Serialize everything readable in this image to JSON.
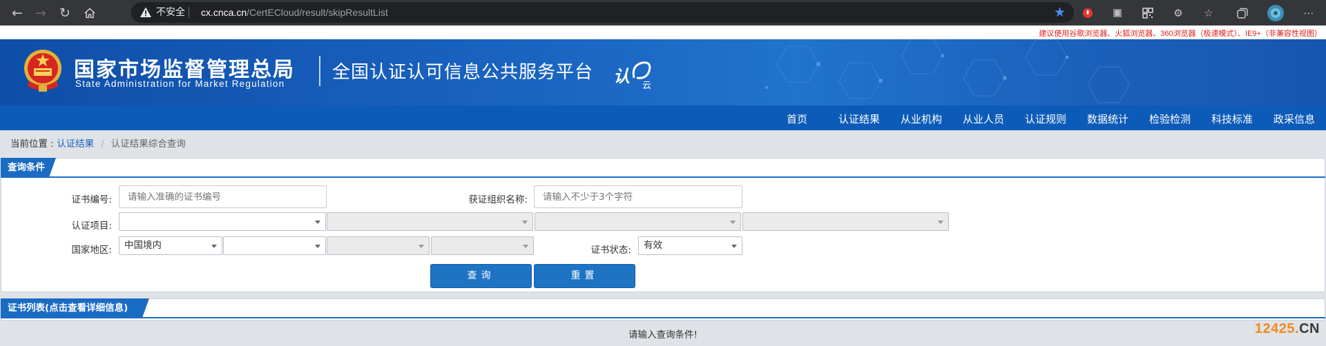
{
  "browser": {
    "security_label": "不安全",
    "url_host": "cx.cnca.cn",
    "url_path": "/CertECloud/result/skipResultList",
    "icons": [
      "back-icon",
      "forward-icon",
      "reload-icon",
      "home-icon",
      "warning-icon",
      "bookmark-star-icon",
      "extension-icons",
      "profile-avatar-icon"
    ]
  },
  "notice": "建议使用谷歌浏览器、火狐浏览器、360浏览器（极速模式）、IE9+（非兼容性视图）",
  "header": {
    "org_cn": "国家市场监督管理总局",
    "org_en": "State Administration  for  Market Regulation",
    "platform": "全国认证认可信息公共服务平台",
    "brand_char": "认",
    "brand_sub": "云"
  },
  "nav": [
    "首页",
    "认证结果",
    "从业机构",
    "从业人员",
    "认证规则",
    "数据统计",
    "检验检测",
    "科技标准",
    "政采信息"
  ],
  "breadcrumb": {
    "prefix": "当前位置 : ",
    "link": "认证结果",
    "separator": "/",
    "current": "认证结果综合查询"
  },
  "query_panel": {
    "title": "查询条件",
    "cert_no_label": "证书编号:",
    "cert_no_placeholder": "请输入准确的证书编号",
    "org_name_label": "获证组织名称:",
    "org_name_placeholder": "请输入不少于3个字符",
    "project_label": "认证项目:",
    "region_label": "国家地区:",
    "region_value": "中国境内",
    "status_label": "证书状态:",
    "status_value": "有效",
    "search_button": "查询",
    "reset_button": "重置"
  },
  "list_panel": {
    "title": "证书列表(点击查看详细信息)",
    "empty_message": "请输入查询条件!"
  },
  "watermark": {
    "num": "12425",
    "dot": ".",
    "cn": "CN"
  },
  "colors": {
    "brand_blue": "#0d5bb8",
    "notice_red": "#e0201a",
    "button_blue": "#1f73c3",
    "watermark_orange": "#f08a1c"
  }
}
